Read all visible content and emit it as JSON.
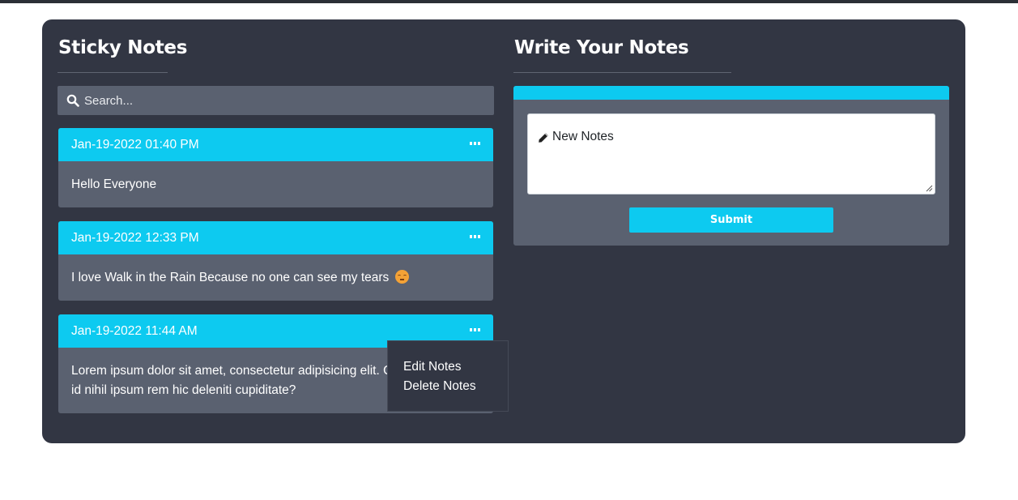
{
  "left": {
    "title": "Sticky Notes",
    "search": {
      "placeholder": "Search...",
      "icon": "search-icon"
    },
    "notes": [
      {
        "date": "Jan-19-2022 01:40 PM",
        "text": "Hello Everyone"
      },
      {
        "date": "Jan-19-2022 12:33 PM",
        "text": "I love Walk in the Rain Because no one can see my tears",
        "emoji": "pensive-face"
      },
      {
        "date": "Jan-19-2022 11:44 AM",
        "text": "Lorem ipsum dolor sit amet, consectetur adipisicing elit. Omnis dolor ipsa id nihil ipsum rem hic deleniti cupiditate?"
      }
    ],
    "menu": {
      "edit_label": "Edit Notes",
      "delete_label": "Delete Notes"
    }
  },
  "right": {
    "title": "Write Your Notes",
    "textarea_placeholder": "New Notes",
    "submit_label": "Submit"
  },
  "colors": {
    "panel": "#323643",
    "card": "#5a6170",
    "accent": "#0dcaf0"
  }
}
